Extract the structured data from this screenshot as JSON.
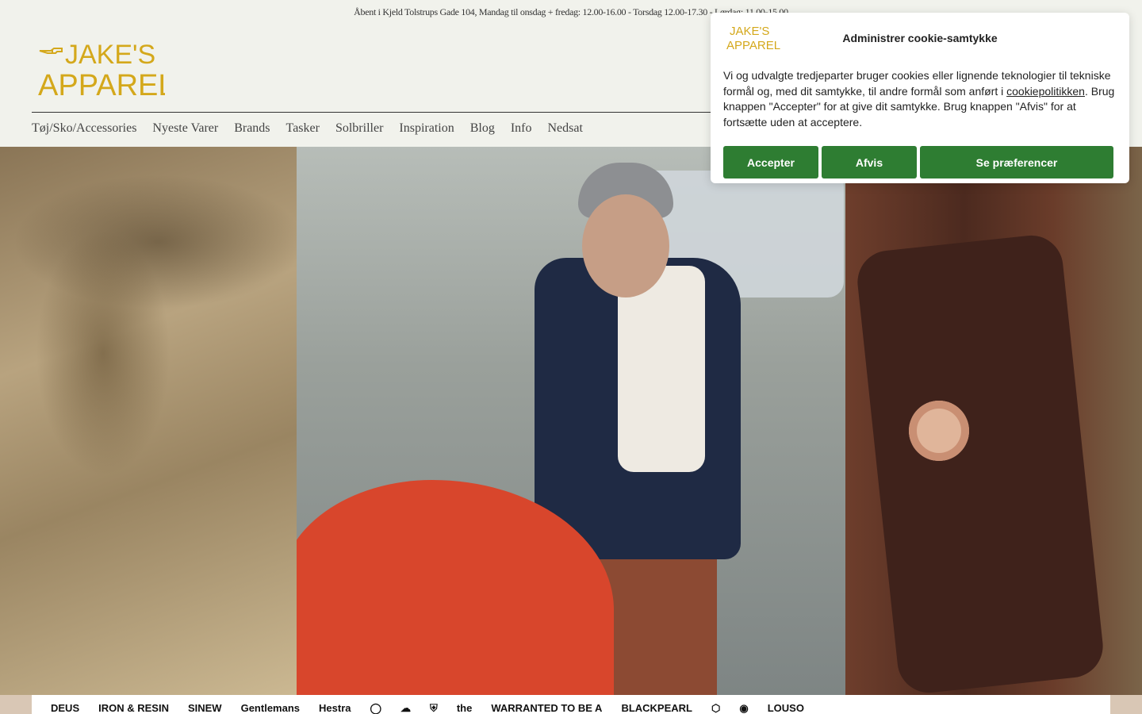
{
  "announcement": "Åbent i Kjeld Tolstrups Gade 104, Mandag til onsdag + fredag: 12.00-16.00 - Torsdag 12.00-17.30 - Lørdag: 11.00-15.00",
  "brand": {
    "logo_line1": "JAKE'S",
    "logo_line2": "APPAREL",
    "logo_color": "#d4a81b"
  },
  "nav": {
    "items": [
      {
        "label": "Tøj/Sko/Accessories"
      },
      {
        "label": "Nyeste Varer"
      },
      {
        "label": "Brands"
      },
      {
        "label": "Tasker"
      },
      {
        "label": "Solbriller"
      },
      {
        "label": "Inspiration"
      },
      {
        "label": "Blog"
      },
      {
        "label": "Info"
      },
      {
        "label": "Nedsat"
      }
    ]
  },
  "brands_strip": {
    "logos": [
      "DEUS",
      "IRON & RESIN",
      "SINEW",
      "Gentlemans",
      "Hestra",
      "◯",
      "",
      "☁",
      "⛨",
      "the",
      "WARRANTED TO BE A",
      "BLACKPEARL",
      "⬡",
      "◉",
      "LOUSO"
    ]
  },
  "cookie": {
    "title": "Administrer cookie-samtykke",
    "logo_line1": "JAKE'S",
    "logo_line2": "APPAREL",
    "text_before_link": "Vi og udvalgte tredjeparter bruger cookies eller lignende teknologier til tekniske formål og, med dit samtykke, til andre formål som anført i ",
    "link_text": "cookiepolitikken",
    "text_after_link": ". Brug knappen \"Accepter\" for at give dit samtykke. Brug knappen \"Afvis\" for at fortsætte uden at acceptere.",
    "accept_label": "Accepter",
    "decline_label": "Afvis",
    "prefs_label": "Se præferencer",
    "button_color": "#2e7d32"
  }
}
